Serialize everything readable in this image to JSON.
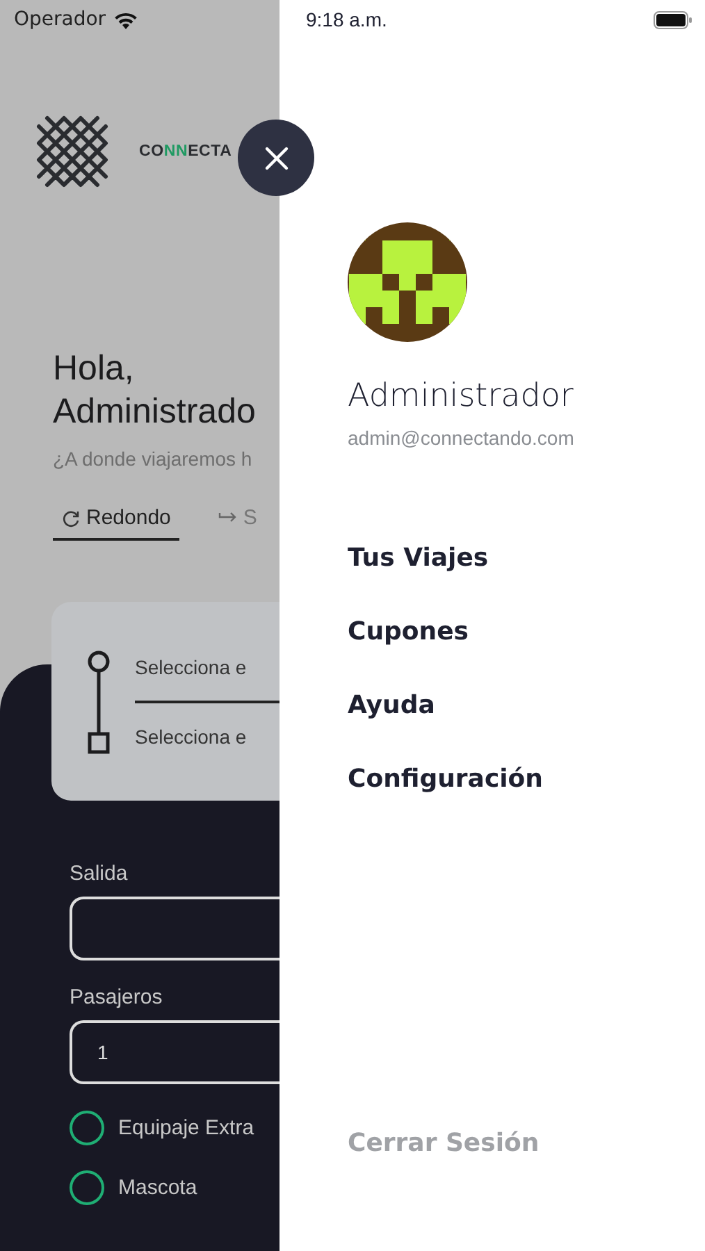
{
  "status_bar": {
    "carrier": "Operador",
    "time": "9:18 a.m."
  },
  "background": {
    "logo_parts": [
      {
        "text": "CO",
        "accent": false
      },
      {
        "text": "NN",
        "accent": true
      },
      {
        "text": "ECTA",
        "accent": false
      }
    ],
    "greeting": "Hola,",
    "user_name": "Administrado",
    "subtitle": "¿A donde viajaremos h",
    "tabs": [
      {
        "label": "Redondo",
        "kind": "round",
        "selected": true
      },
      {
        "label": "S",
        "kind": "oneway",
        "selected": false
      }
    ],
    "route": {
      "origin": "Selecciona e",
      "destination": "Selecciona e"
    },
    "form": [
      {
        "label": "Salida"
      },
      {
        "label": "Pasajeros",
        "value": "1"
      }
    ],
    "options": [
      {
        "label": "Equipaje Extra",
        "checked": false
      },
      {
        "label": "Mascota",
        "checked": false
      }
    ]
  },
  "drawer": {
    "name": "Administrador",
    "email": "admin@connectando.com",
    "menu": [
      "Tus Viajes",
      "Cupones",
      "Ayuda",
      "Configuración"
    ],
    "logout": "Cerrar Sesión"
  }
}
